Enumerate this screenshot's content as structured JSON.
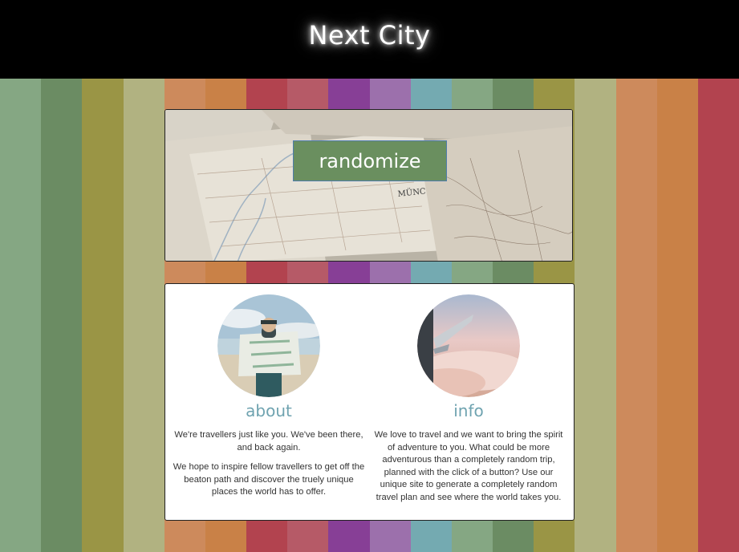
{
  "header": {
    "title": "Next City"
  },
  "stripes": [
    "#85a783",
    "#6b8c63",
    "#9a9545",
    "#b1b281",
    "#cd8a5c",
    "#c98147",
    "#b2434f",
    "#b65a67",
    "#873f96",
    "#9c70ac",
    "#74aab1",
    "#85a783",
    "#6b8c63",
    "#9a9545",
    "#b1b281",
    "#cd8a5c",
    "#c98147",
    "#b2434f"
  ],
  "hero": {
    "button_label": "randomize",
    "map_text": "MÜNC"
  },
  "about": {
    "heading": "about",
    "paragraphs": [
      "We're travellers just like you. We've been there, and back again.",
      "We hope to inspire fellow travellers to get off the beaton path and discover the truely unique places the world has to offer."
    ]
  },
  "info": {
    "heading": "info",
    "paragraphs": [
      "We love to travel and we want to bring the spirit of adventure to you. What could be more adventurous than a completely random trip, planned with the click of a button? Use our unique site to generate a completely random travel plan and see where the world takes you."
    ]
  },
  "colors": {
    "button_bg": "#6a8f5f",
    "heading_color": "#6fa3b0"
  }
}
